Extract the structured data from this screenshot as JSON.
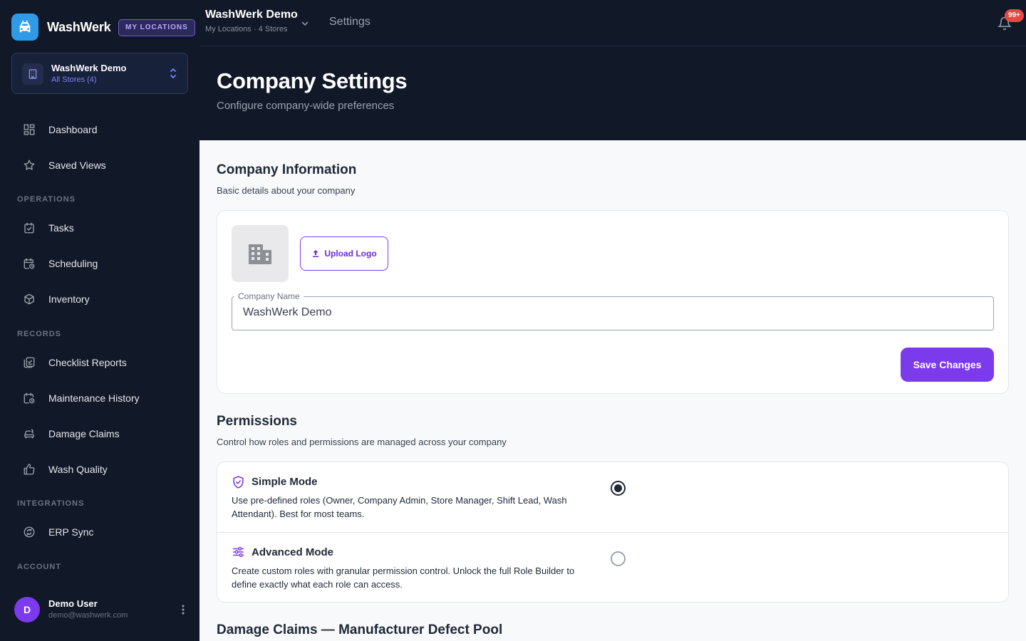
{
  "brand": {
    "name": "WashWerk",
    "badge": "MY LOCATIONS"
  },
  "company_switcher": {
    "name": "WashWerk Demo",
    "subtitle": "All Stores (4)"
  },
  "nav": {
    "top": [
      {
        "label": "Dashboard",
        "icon": "dashboard-icon"
      },
      {
        "label": "Saved Views",
        "icon": "star-icon"
      }
    ],
    "operations_title": "OPERATIONS",
    "operations": [
      {
        "label": "Tasks",
        "icon": "task-check-icon"
      },
      {
        "label": "Scheduling",
        "icon": "calendar-clock-icon"
      },
      {
        "label": "Inventory",
        "icon": "box-icon"
      }
    ],
    "records_title": "RECORDS",
    "records": [
      {
        "label": "Checklist Reports",
        "icon": "checklist-icon"
      },
      {
        "label": "Maintenance History",
        "icon": "history-icon"
      },
      {
        "label": "Damage Claims",
        "icon": "car-damage-icon"
      },
      {
        "label": "Wash Quality",
        "icon": "thumbs-up-icon"
      }
    ],
    "integrations_title": "INTEGRATIONS",
    "integrations": [
      {
        "label": "ERP Sync",
        "icon": "sync-icon"
      }
    ],
    "account_title": "ACCOUNT"
  },
  "user": {
    "initial": "D",
    "name": "Demo User",
    "email": "demo@washwerk.com"
  },
  "topbar": {
    "title": "WashWerk Demo",
    "subtitle": "My Locations · 4 Stores",
    "breadcrumb": "Settings",
    "notification_count": "99+"
  },
  "header": {
    "title": "Company Settings",
    "subtitle": "Configure company-wide preferences"
  },
  "company_info": {
    "title": "Company Information",
    "subtitle": "Basic details about your company",
    "upload_label": "Upload Logo",
    "name_label": "Company Name",
    "name_value": "WashWerk Demo",
    "save_label": "Save Changes"
  },
  "permissions": {
    "title": "Permissions",
    "subtitle": "Control how roles and permissions are managed across your company",
    "options": [
      {
        "title": "Simple Mode",
        "description": "Use pre-defined roles (Owner, Company Admin, Store Manager, Shift Lead, Wash Attendant). Best for most teams.",
        "selected": true
      },
      {
        "title": "Advanced Mode",
        "description": "Create custom roles with granular permission control. Unlock the full Role Builder to define exactly what each role can access.",
        "selected": false
      }
    ]
  },
  "damage_claims": {
    "title": "Damage Claims — Manufacturer Defect Pool"
  },
  "colors": {
    "accent": "#7c3aed",
    "sidebar_bg": "#111827",
    "brand_blue": "#2f9ae8",
    "badge_red": "#ef4444"
  }
}
